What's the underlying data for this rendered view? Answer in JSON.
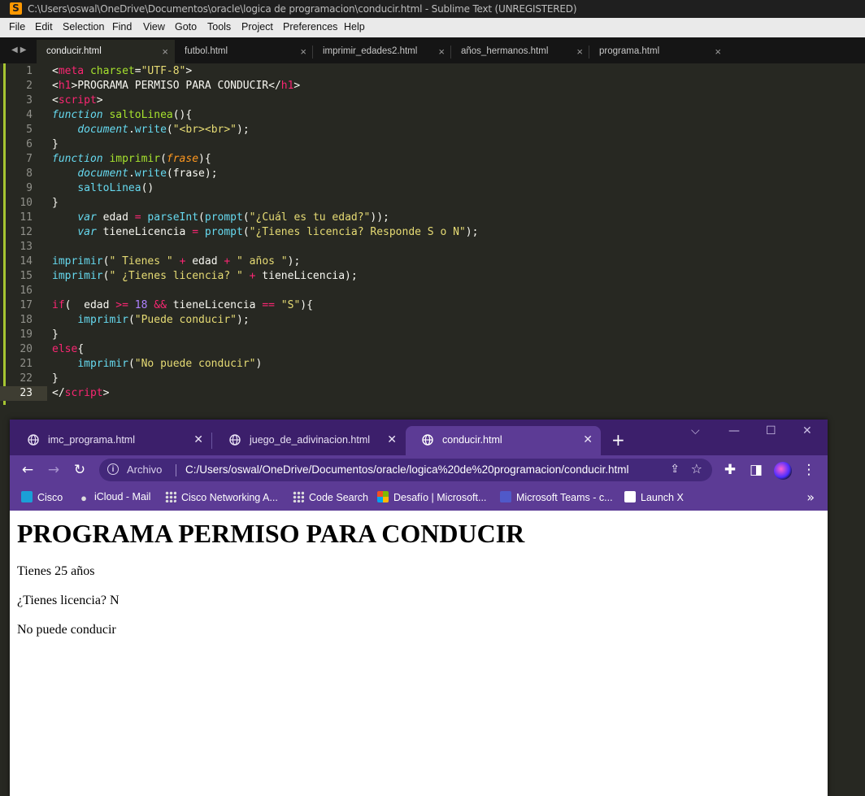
{
  "sublime": {
    "title": "C:\\Users\\oswal\\OneDrive\\Documentos\\oracle\\logica de programacion\\conducir.html - Sublime Text (UNREGISTERED)",
    "menu": [
      "File",
      "Edit",
      "Selection",
      "Find",
      "View",
      "Goto",
      "Tools",
      "Project",
      "Preferences",
      "Help"
    ],
    "tabs": [
      "conducir.html",
      "futbol.html",
      "imprimir_edades2.html",
      "años_hermanos.html",
      "programa.html"
    ],
    "active_tab": "conducir.html",
    "line_numbers": [
      "1",
      "2",
      "3",
      "4",
      "5",
      "6",
      "7",
      "8",
      "9",
      "10",
      "11",
      "12",
      "13",
      "14",
      "15",
      "16",
      "17",
      "18",
      "19",
      "20",
      "21",
      "22",
      "23"
    ],
    "current_line": "23"
  },
  "chrome": {
    "tabs": [
      "imc_programa.html",
      "juego_de_adivinacion.html",
      "conducir.html"
    ],
    "active_tab": "conducir.html",
    "address": {
      "label": "Archivo",
      "url": "C:/Users/oswal/OneDrive/Documentos/oracle/logica%20de%20programacion/conducir.html"
    },
    "bookmarks": [
      "Cisco",
      "iCloud - Mail",
      "Cisco Networking A...",
      "Code Search",
      "Desafío | Microsoft...",
      "Microsoft Teams - c...",
      "Launch X"
    ],
    "page": {
      "heading": "PROGRAMA PERMISO PARA CONDUCIR",
      "lines": [
        "Tienes 25 años",
        "¿Tienes licencia? N",
        "No puede conducir"
      ]
    }
  }
}
